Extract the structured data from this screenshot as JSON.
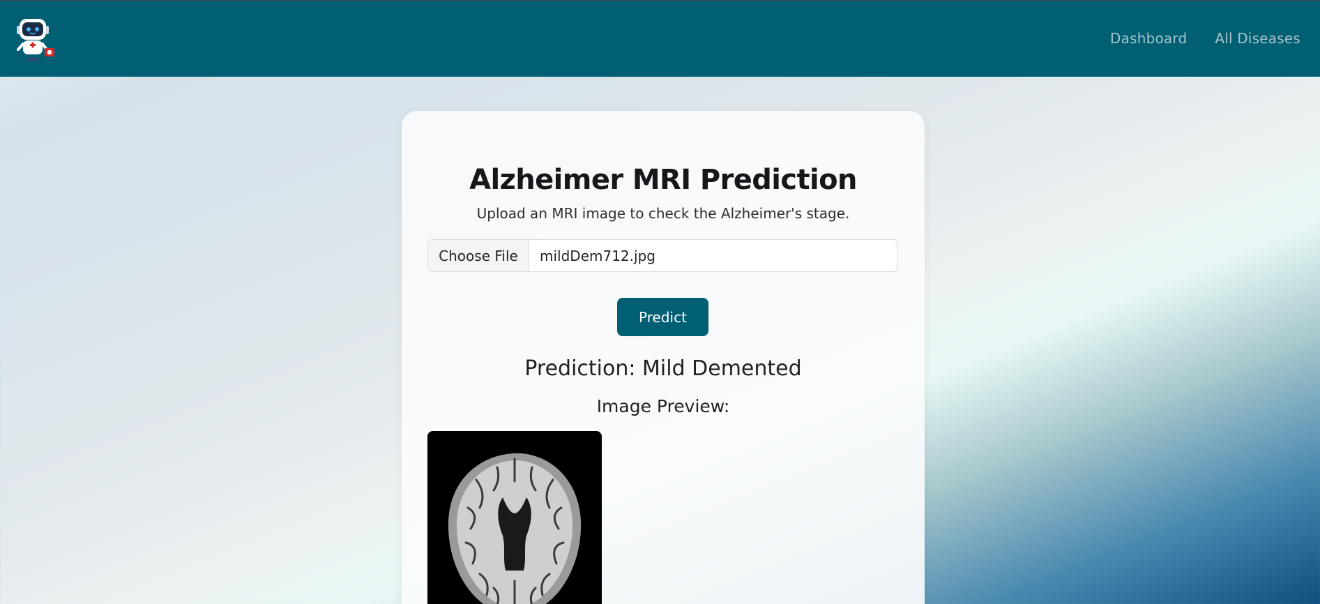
{
  "nav": {
    "logo_icon": "robot-doctor-logo-icon",
    "links": [
      {
        "label": "Dashboard"
      },
      {
        "label": "All Diseases"
      }
    ]
  },
  "card": {
    "title": "Alzheimer MRI Prediction",
    "subtitle": "Upload an MRI image to check the Alzheimer's stage.",
    "file_input": {
      "button_label": "Choose File",
      "file_name": "mildDem712.jpg"
    },
    "predict_button": "Predict",
    "prediction_label": "Prediction:",
    "prediction_value": "Mild Demented",
    "preview_label": "Image Preview:",
    "preview_icon": "brain-mri-image"
  },
  "colors": {
    "primary": "#005f73",
    "nav_link": "#a9c4cd"
  }
}
